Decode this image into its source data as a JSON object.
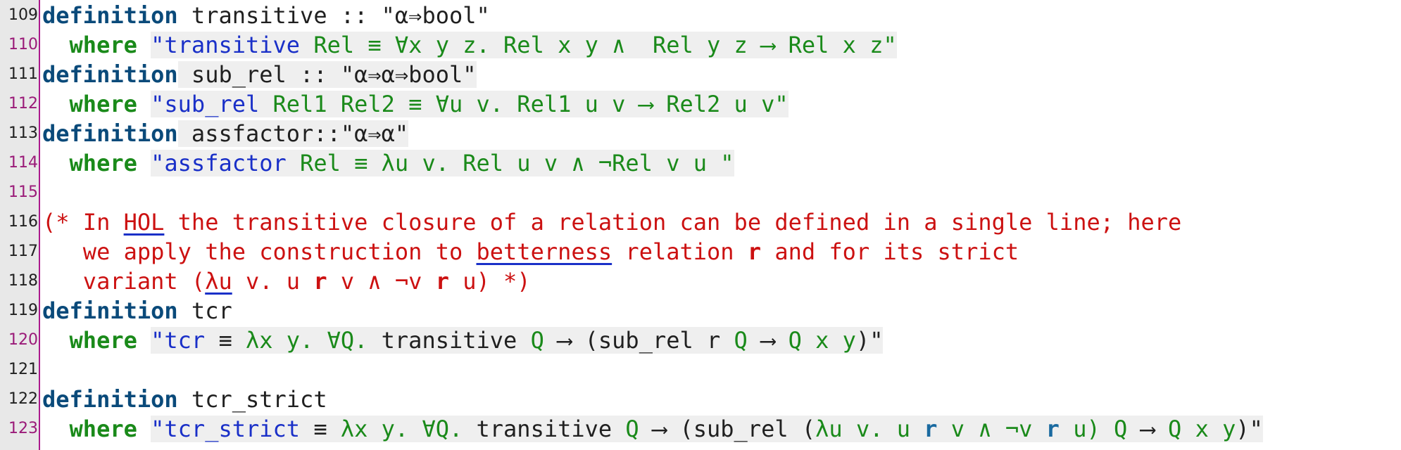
{
  "lines": [
    {
      "n": "109",
      "t": [
        [
          "definition",
          "kw"
        ],
        [
          " transitive :: \"",
          ""
        ],
        [
          "α⇒bool\"",
          "k"
        ]
      ]
    },
    {
      "n": "110",
      "t": [
        [
          "  ",
          ""
        ],
        [
          "where",
          "kw2"
        ],
        [
          " ",
          ""
        ],
        [
          "\"transitive",
          "b"
        ],
        [
          " Rel ≡ ∀x y z. Rel x y ∧  Rel y z ⟶ Rel x z\"",
          "g"
        ]
      ]
    },
    {
      "n": "111",
      "t": [
        [
          "definition",
          "kw"
        ],
        [
          " sub_rel :: \"α⇒α⇒bool\"",
          ""
        ]
      ]
    },
    {
      "n": "112",
      "t": [
        [
          "  ",
          ""
        ],
        [
          "where",
          "kw2"
        ],
        [
          " ",
          ""
        ],
        [
          "\"sub_rel",
          "b"
        ],
        [
          " Rel1 Rel2 ≡ ∀u v. Rel1 u v ⟶ Rel2 u v\"",
          "g"
        ]
      ]
    },
    {
      "n": "113",
      "t": [
        [
          "definition",
          "kw"
        ],
        [
          " assfactor::\"α⇒α\"",
          ""
        ]
      ]
    },
    {
      "n": "114",
      "t": [
        [
          "  ",
          ""
        ],
        [
          "where",
          "kw2"
        ],
        [
          " ",
          ""
        ],
        [
          "\"assfactor",
          "b"
        ],
        [
          " Rel ≡ λu v. Rel u v ∧ ¬Rel v u \"",
          "g"
        ]
      ]
    },
    {
      "n": "115",
      "t": []
    },
    {
      "n": "116",
      "t": [
        [
          "(* In ",
          "cm"
        ],
        [
          "HOL",
          "cm ul"
        ],
        [
          " the transitive closure of a relation can be defined in a single line; here",
          "cm"
        ]
      ]
    },
    {
      "n": "117",
      "t": [
        [
          "   we apply the construction to ",
          "cm"
        ],
        [
          "betterness",
          "cm ul"
        ],
        [
          " relation ",
          "cm"
        ],
        [
          "r",
          "cm bold"
        ],
        [
          " and for its strict",
          "cm"
        ]
      ]
    },
    {
      "n": "118",
      "t": [
        [
          "   variant (",
          "cm"
        ],
        [
          "λu",
          "cm ul"
        ],
        [
          " v. u ",
          "cm"
        ],
        [
          "r",
          "cm bold"
        ],
        [
          " v ∧ ¬v ",
          "cm"
        ],
        [
          "r",
          "cm bold"
        ],
        [
          " u) *)",
          "cm"
        ]
      ]
    },
    {
      "n": "119",
      "t": [
        [
          "definition",
          "kw"
        ],
        [
          " tcr",
          ""
        ]
      ]
    },
    {
      "n": "120",
      "t": [
        [
          "  ",
          ""
        ],
        [
          "where",
          "kw2"
        ],
        [
          " ",
          ""
        ],
        [
          "\"tcr",
          "b"
        ],
        [
          " ≡ ",
          "k"
        ],
        [
          "λx y. ∀Q.",
          "g"
        ],
        [
          " transitive ",
          "k"
        ],
        [
          "Q",
          "g"
        ],
        [
          " ⟶ (sub_rel r ",
          "k"
        ],
        [
          "Q",
          "g"
        ],
        [
          " ⟶ ",
          "k"
        ],
        [
          "Q x y",
          "g"
        ],
        [
          ")\"",
          "k"
        ]
      ]
    },
    {
      "n": "121",
      "t": []
    },
    {
      "n": "122",
      "t": [
        [
          "definition",
          "kw"
        ],
        [
          " tcr_strict",
          ""
        ]
      ]
    },
    {
      "n": "123",
      "t": [
        [
          "  ",
          ""
        ],
        [
          "where",
          "kw2"
        ],
        [
          " ",
          ""
        ],
        [
          "\"tcr_strict",
          "b"
        ],
        [
          " ≡ ",
          "k"
        ],
        [
          "λx y. ∀Q.",
          "g"
        ],
        [
          " transitive ",
          "k"
        ],
        [
          "Q",
          "g"
        ],
        [
          " ⟶ (sub_rel (",
          "k"
        ],
        [
          "λu v. u ",
          "g"
        ],
        [
          "r",
          "bb"
        ],
        [
          " v ∧ ¬v ",
          "g"
        ],
        [
          "r",
          "bb"
        ],
        [
          " u) ",
          "g"
        ],
        [
          "Q",
          "g"
        ],
        [
          " ⟶ ",
          "k"
        ],
        [
          "Q x y",
          "g"
        ],
        [
          ")\"",
          "k"
        ]
      ]
    }
  ]
}
